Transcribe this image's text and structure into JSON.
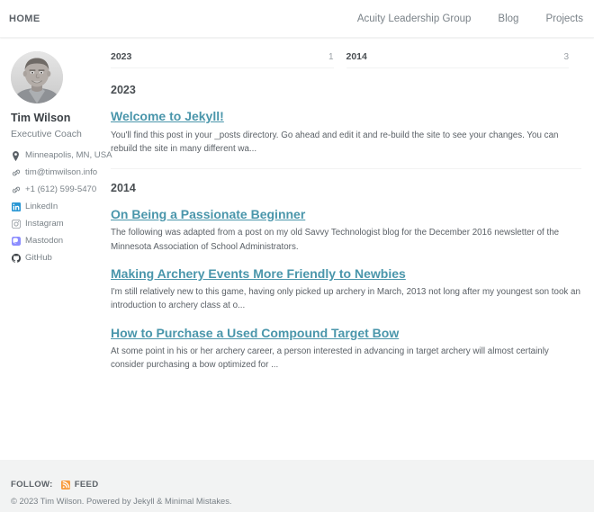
{
  "masthead": {
    "site_title": "HOME",
    "nav": [
      {
        "label": "Acuity Leadership Group",
        "icon": "nav-link"
      },
      {
        "label": "Blog",
        "icon": "nav-link"
      },
      {
        "label": "Projects",
        "icon": "nav-link"
      }
    ]
  },
  "sidebar": {
    "avatar_alt": "Tim Wilson headshot",
    "name": "Tim Wilson",
    "bio": "Executive Coach",
    "links": [
      {
        "label": "Minneapolis, MN, USA",
        "icon": "map-pin-icon",
        "color": "#7a8288"
      },
      {
        "label": "tim@timwilson.info",
        "icon": "link-icon",
        "color": "#7a8288"
      },
      {
        "label": "+1 (612) 599-5470",
        "icon": "link-icon",
        "color": "#7a8288"
      },
      {
        "label": "LinkedIn",
        "icon": "linkedin-icon",
        "color": "#0077b5"
      },
      {
        "label": "Instagram",
        "icon": "instagram-icon",
        "color": "#9ba1a6"
      },
      {
        "label": "Mastodon",
        "icon": "mastodon-icon",
        "color": "#8c8dff"
      },
      {
        "label": "GitHub",
        "icon": "github-icon",
        "color": "#3b4045"
      }
    ]
  },
  "main": {
    "taxonomy_index": [
      {
        "name": "2023",
        "count": "1"
      },
      {
        "name": "2014",
        "count": "3"
      }
    ],
    "sections": [
      {
        "year": "2023",
        "posts": [
          {
            "title": "Welcome to Jekyll!",
            "excerpt": "You'll find this post in your _posts directory. Go ahead and edit it and re-build the site to see your changes. You can rebuild the site in many different wa..."
          }
        ]
      },
      {
        "year": "2014",
        "posts": [
          {
            "title": "On Being a Passionate Beginner",
            "excerpt": "The following was adapted from a post on my old Savvy Technologist blog for the December 2016 newsletter of the Minnesota Association of School Administrators."
          },
          {
            "title": "Making Archery Events More Friendly to Newbies",
            "excerpt": "I'm still relatively new to this game, having only picked up archery in March, 2013 not long after my youngest son took an introduction to archery class at o..."
          },
          {
            "title": "How to Purchase a Used Compound Target Bow",
            "excerpt": "At some point in his or her archery career, a person interested in advancing in target archery will almost certainly consider purchasing a bow optimized for ..."
          }
        ]
      }
    ]
  },
  "footer": {
    "follow_label": "FOLLOW:",
    "feed_label": "FEED",
    "feed_icon": "rss-icon",
    "feed_icon_color": "#f89c3f",
    "copyright": "© 2023 Tim Wilson. Powered by Jekyll & Minimal Mistakes."
  },
  "theme": {
    "link_color": "#4a96ab",
    "text_color": "#3b4045",
    "muted_color": "#7a8288",
    "border_color": "#f2f3f3",
    "footer_bg": "#f2f3f3"
  }
}
